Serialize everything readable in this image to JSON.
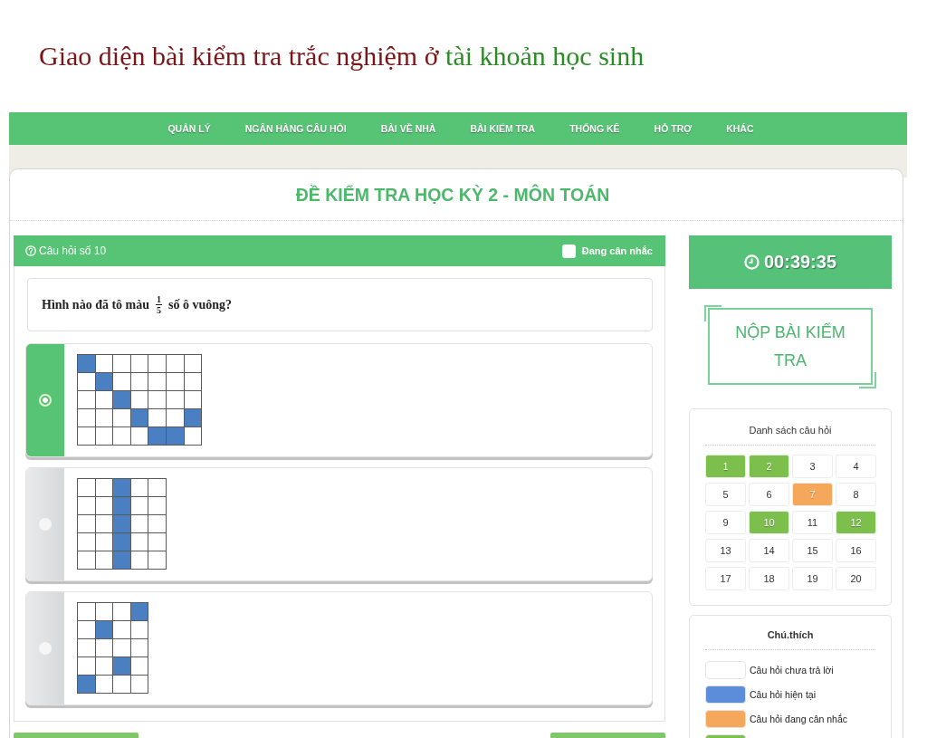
{
  "page_title": {
    "parts": [
      {
        "text": "Giao diện bài kiểm tra trắc nghiệm ở",
        "color": "#7a1518"
      },
      {
        "text": "tài khoản học sinh",
        "color": "#2a8c24"
      }
    ]
  },
  "nav": {
    "items": [
      "QUẢN LÝ",
      "NGÂN HÀNG CÂU HỎI",
      "BÀI VỀ NHÀ",
      "BÀI KIỂM TRA",
      "THỐNG KÊ",
      "HỖ TRỢ",
      "KHÁC"
    ]
  },
  "exam_title": "ĐỀ KIỂM TRA HỌC KỲ 2 - MÔN TOÁN",
  "question": {
    "label": "Câu hỏi số 10",
    "flag": {
      "label": "Đang cân nhắc",
      "checked": false
    },
    "text": {
      "before": "Hình nào đã tô màu",
      "numerator": "1",
      "denominator": "5",
      "after": "số ô vuông?"
    },
    "answers": [
      {
        "selected": true,
        "grid": [
          [
            true,
            false,
            false,
            false,
            false,
            false,
            false
          ],
          [
            false,
            true,
            false,
            false,
            false,
            false,
            false
          ],
          [
            false,
            false,
            true,
            false,
            false,
            false,
            false
          ],
          [
            false,
            false,
            false,
            true,
            false,
            false,
            true
          ],
          [
            false,
            false,
            false,
            false,
            true,
            true,
            false
          ]
        ]
      },
      {
        "selected": false,
        "grid": [
          [
            false,
            false,
            true,
            false,
            false
          ],
          [
            false,
            false,
            true,
            false,
            false
          ],
          [
            false,
            false,
            true,
            false,
            false
          ],
          [
            false,
            false,
            true,
            false,
            false
          ],
          [
            false,
            false,
            true,
            false,
            false
          ]
        ]
      },
      {
        "selected": false,
        "grid": [
          [
            false,
            false,
            false,
            true
          ],
          [
            false,
            true,
            false,
            false
          ],
          [
            false,
            false,
            false,
            false
          ],
          [
            false,
            false,
            true,
            false
          ],
          [
            true,
            false,
            false,
            false
          ]
        ]
      }
    ]
  },
  "timer": "00:39:35",
  "submit_button": "NỘP BÀI KIỂM TRA",
  "question_list": {
    "title": "Danh sách câu hỏi",
    "items": [
      {
        "number": "1",
        "color": "#7dbf4c"
      },
      {
        "number": "2",
        "color": "#7dbf4c"
      },
      {
        "number": "3",
        "color": "#ffffff"
      },
      {
        "number": "4",
        "color": "#ffffff"
      },
      {
        "number": "5",
        "color": "#ffffff"
      },
      {
        "number": "6",
        "color": "#ffffff"
      },
      {
        "number": "7",
        "color": "#f5a85c"
      },
      {
        "number": "8",
        "color": "#ffffff"
      },
      {
        "number": "9",
        "color": "#ffffff"
      },
      {
        "number": "10",
        "color": "#7dbf4c"
      },
      {
        "number": "11",
        "color": "#ffffff"
      },
      {
        "number": "12",
        "color": "#7dbf4c"
      },
      {
        "number": "13",
        "color": "#ffffff"
      },
      {
        "number": "14",
        "color": "#ffffff"
      },
      {
        "number": "15",
        "color": "#ffffff"
      },
      {
        "number": "16",
        "color": "#ffffff"
      },
      {
        "number": "17",
        "color": "#ffffff"
      },
      {
        "number": "18",
        "color": "#ffffff"
      },
      {
        "number": "19",
        "color": "#ffffff"
      },
      {
        "number": "20",
        "color": "#ffffff"
      }
    ]
  },
  "legend": {
    "title": "Chú.thích",
    "items": [
      {
        "label": "Câu hỏi chưa trả lời",
        "color": "#ffffff"
      },
      {
        "label": "Câu hỏi hiện tại",
        "color": "#5b8ddb"
      },
      {
        "label": "Câu hỏi đang cân nhắc",
        "color": "#f5a85c"
      },
      {
        "color": "#7dbf4c"
      }
    ]
  }
}
